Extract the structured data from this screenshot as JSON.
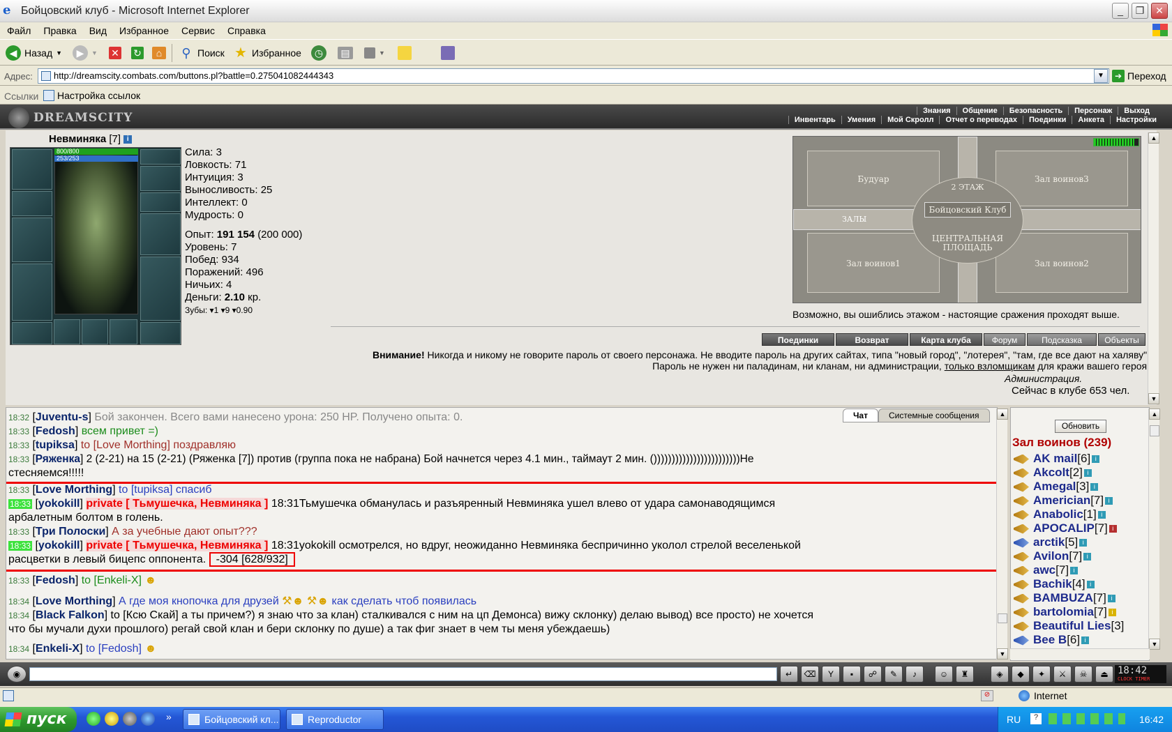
{
  "window": {
    "title": "Бойцовский клуб - Microsoft Internet Explorer"
  },
  "menu": [
    "Файл",
    "Правка",
    "Вид",
    "Избранное",
    "Сервис",
    "Справка"
  ],
  "toolbar": {
    "back": "Назад",
    "search": "Поиск",
    "favorites": "Избранное"
  },
  "address": {
    "label": "Адрес:",
    "url": "http://dreamscity.combats.com/buttons.pl?battle=0.275041082444343",
    "go": "Переход"
  },
  "links": {
    "label": "Ссылки",
    "item": "Настройка ссылок"
  },
  "site": {
    "logo": "DREAMSCITY",
    "nav_top": [
      "Знания",
      "Общение",
      "Безопасность",
      "Персонаж",
      "Выход"
    ],
    "nav_sub": [
      "Инвентарь",
      "Умения",
      "Мой Скролл",
      "Отчет о переводах",
      "Поединки",
      "Анкета",
      "Настройки"
    ]
  },
  "character": {
    "name": "Невминяка",
    "level": "[7]",
    "hp": "800/800",
    "mp": "253/253",
    "stats": [
      {
        "label": "Сила:",
        "value": "3"
      },
      {
        "label": "Ловкость:",
        "value": "71"
      },
      {
        "label": "Интуиция:",
        "value": "3"
      },
      {
        "label": "Выносливость:",
        "value": "25"
      },
      {
        "label": "Интеллект:",
        "value": "0"
      },
      {
        "label": "Мудрость:",
        "value": "0"
      }
    ],
    "exp_label": "Опыт:",
    "exp_value": "191 154",
    "exp_next": "(200 000)",
    "level_label": "Уровень: 7",
    "wins": "Побед: 934",
    "losses": "Поражений: 496",
    "draws": "Ничьих: 4",
    "money_label": "Деньги:",
    "money_value": "2.10",
    "money_unit": "кр.",
    "teeth": "Зубы: ▾1 ▾9 ▾0.90"
  },
  "map": {
    "rooms": [
      "Будуар",
      "Зал воинов3",
      "2 ЭТАЖ",
      "Бойцовский Клуб",
      "ЗАЛЫ",
      "ЦЕНТРАЛЬНАЯ ПЛОЩАДЬ",
      "Зал воинов1",
      "Зал воинов2"
    ],
    "message": "Возможно, вы ошиблись этажом - настоящие сражения проходят выше."
  },
  "buttons": [
    "Поединки",
    "Возврат",
    "Карта клуба",
    "Форум",
    "Подсказка",
    "Объекты"
  ],
  "warning": {
    "bold": "Внимание!",
    "text1": " Никогда и никому не говорите пароль от своего персонажа. Не вводите пароль на других сайтах, типа \"новый город\", \"лотерея\", \"там, где все дают на халяву\". Пароль не нужен ни паладинам, ни кланам, ни администрации, ",
    "link": "только взломщикам",
    "text2": " для кражи вашего героя.",
    "signature": "Администрация.",
    "online": "Сейчас в клубе 653 чел."
  },
  "chat": {
    "tabs": [
      "Чат",
      "Системные сообщения"
    ],
    "lines": [
      {
        "time": "18:32",
        "nick": "Juventu-s",
        "text": "Бой закончен. Всего вами нанесено урона: 250 HP. Получено опыта: 0."
      },
      {
        "time": "18:33",
        "nick": "Fedosh",
        "text": "всем привет =)"
      },
      {
        "time": "18:33",
        "nick": "tupiksa",
        "to": "to [Love Morthing]",
        "text": "поздравляю"
      },
      {
        "time": "18:33",
        "nick": "Ряженка",
        "text": "2 (2-21) на 15 (2-21) (Ряженка [7]) против (группа пока не набрана) Бой начнется через 4.1 мин., таймаут 2 мин. ())))))))))))))))))))))))Не",
        "cont": "стесняемся!!!!!"
      },
      {
        "time": "18:33",
        "nick": "Love Morthing",
        "to": "to [tupiksa]",
        "text": "спасиб"
      },
      {
        "time": "18:33",
        "nick": "yokokill",
        "priv": "private [ Тьмушечка, Невминяка ]",
        "text": "18:31Тьмушечка обманулась и разъяренный Невминяка ушел влево от удара самонаводящимся",
        "cont": "арбалетным болтом в голень."
      },
      {
        "time": "18:33",
        "nick": "Три Полоски",
        "text": "А за учебные дают опыт???"
      },
      {
        "time": "18:33",
        "nick": "yokokill",
        "priv": "private [ Тьмушечка, Невминяка ]",
        "text": "18:31yokokill осмотрелся, но вдруг, неожиданно Невминяка беспричинно уколол стрелой веселенькой",
        "cont": "расцветки в левый бицепс оппонента.",
        "dmg": "-304 [628/932]"
      },
      {
        "time": "18:33",
        "nick": "Fedosh",
        "to": "to [Enkeli-X]",
        "text": ""
      },
      {
        "time": "18:34",
        "nick": "Love Morthing",
        "text": "А где моя кнопочка для друзей",
        "text2": "как сделать чтоб появилась"
      },
      {
        "time": "18:34",
        "nick": "Black Falkon",
        "text": "to [Ксю Скай] а ты причем?) я знаю что за клан) сталкивался с ним на цп Демонса) вижу склонку) делаю вывод) все просто) не хочется",
        "cont": "что бы мучали духи прошлого) регай свой клан и бери склонку по душе) а так фиг знает в чем ты меня убеждаешь)"
      },
      {
        "time": "18:34",
        "nick": "Enkeli-X",
        "to": "to [Fedosh]",
        "text": ""
      }
    ]
  },
  "users": {
    "refresh": "Обновить",
    "hall": "Зал воинов (239)",
    "list": [
      {
        "name": "AK mail",
        "level": "[6]"
      },
      {
        "name": "Akcolt",
        "level": "[2]"
      },
      {
        "name": "Amegal",
        "level": "[3]"
      },
      {
        "name": "Americian",
        "level": "[7]"
      },
      {
        "name": "Anabolic",
        "level": "[1]"
      },
      {
        "name": "APOCALIP",
        "level": "[7]"
      },
      {
        "name": "arctik",
        "level": "[5]"
      },
      {
        "name": "Avilon",
        "level": "[7]"
      },
      {
        "name": "awc",
        "level": "[7]"
      },
      {
        "name": "Bachik",
        "level": "[4]"
      },
      {
        "name": "BAMBUZA",
        "level": "[7]"
      },
      {
        "name": "bartolomia",
        "level": "[7]"
      },
      {
        "name": "Beautiful Lies",
        "level": "[3]"
      },
      {
        "name": "Bee B",
        "level": "[6]"
      }
    ]
  },
  "clock": {
    "time": "18:42",
    "sub": "CLOCK TIMER"
  },
  "status": {
    "zone": "Internet"
  },
  "taskbar": {
    "start": "пуск",
    "tasks": [
      "Бойцовский кл...",
      "Reproductor de..."
    ],
    "lang": "RU",
    "time": "16:42"
  }
}
